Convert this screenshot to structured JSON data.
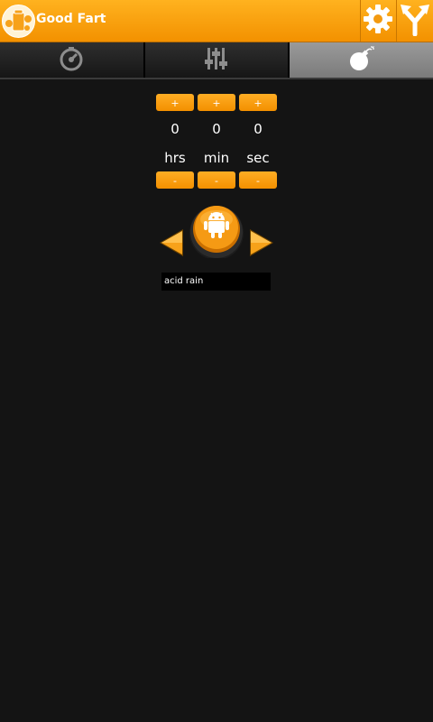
{
  "app": {
    "title": "Good Fart",
    "icons": {
      "logo": "fart-can-logo-icon",
      "settings": "gear-icon",
      "share": "share-fork-icon"
    },
    "colors": {
      "accent": "#f7a21a",
      "background": "#141414",
      "tab_active": "#8a8a8a"
    }
  },
  "tabs": [
    {
      "icon": "stopwatch-icon",
      "active": false
    },
    {
      "icon": "equalizer-sliders-icon",
      "active": false
    },
    {
      "icon": "bomb-icon",
      "active": true
    }
  ],
  "timer": {
    "plus_label": "+",
    "minus_label": "-",
    "hours": {
      "value": "0",
      "unit": "hrs"
    },
    "minutes": {
      "value": "0",
      "unit": "min"
    },
    "seconds": {
      "value": "0",
      "unit": "sec"
    }
  },
  "player": {
    "prev_icon": "arrow-left-icon",
    "play_icon": "android-button-icon",
    "next_icon": "arrow-right-icon",
    "sound_name": "acid rain"
  }
}
